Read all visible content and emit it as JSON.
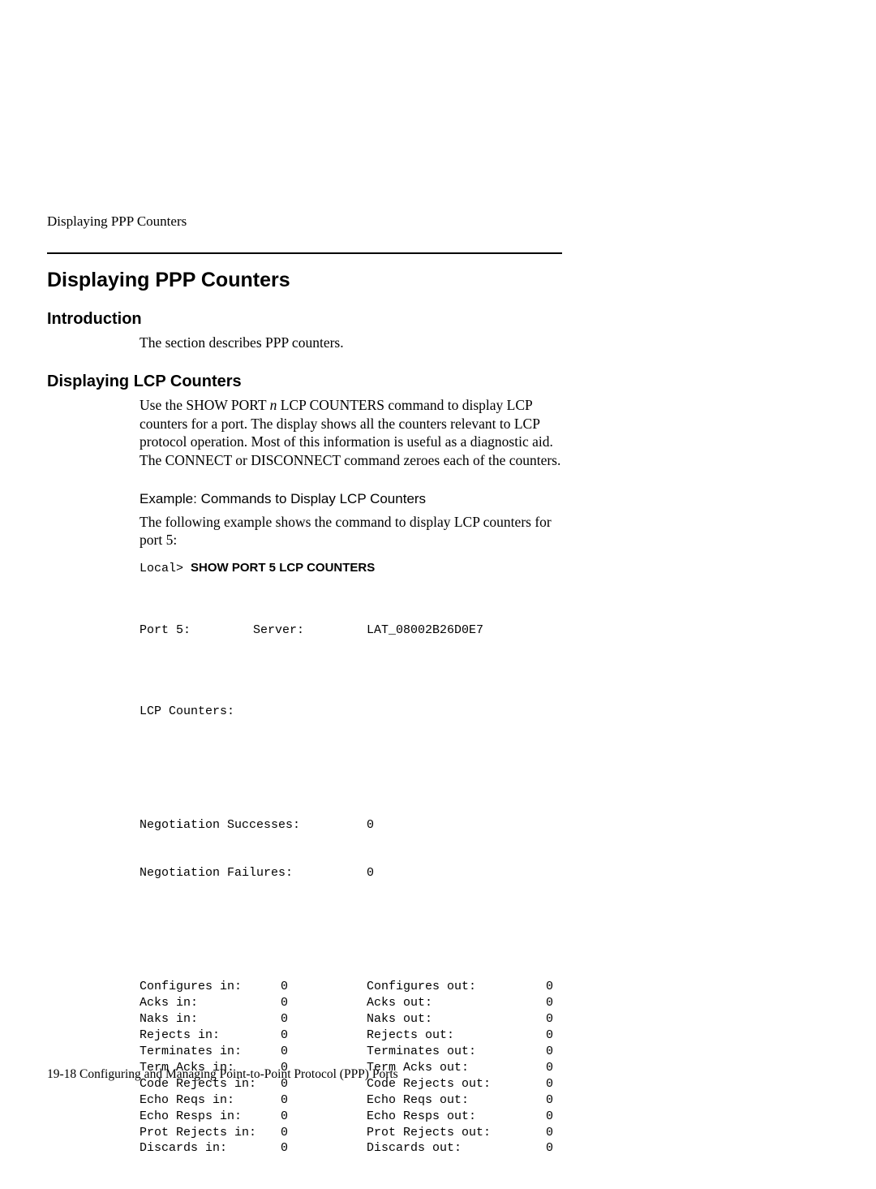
{
  "running_header": "Displaying PPP Counters",
  "h1": "Displaying PPP Counters",
  "intro": {
    "heading": "Introduction",
    "text": "The section describes PPP counters."
  },
  "lcp": {
    "heading": "Displaying LCP Counters",
    "para_before": "Use the SHOW PORT ",
    "para_em": "n",
    "para_after": " LCP COUNTERS command to display LCP counters for a port. The display shows all the counters relevant to LCP protocol operation. Most of this information is useful as a diagnostic aid. The CONNECT or DISCONNECT command zeroes each of the counters.",
    "example_heading": "Example: Commands to Display LCP Counters",
    "example_intro": "The following example shows the command to display LCP counters for port 5:",
    "prompt": "Local> ",
    "command": "SHOW PORT 5 LCP COUNTERS",
    "port_label": "Port 5:",
    "server_label": "Server:",
    "server_value": "LAT_08002B26D0E7",
    "lcp_counters_label": "LCP Counters:",
    "neg_success_label": "Negotiation Successes:",
    "neg_success_val": "0",
    "neg_fail_label": "Negotiation Failures:",
    "neg_fail_val": "0",
    "rows": [
      {
        "l": "Configures in:",
        "lv": "0",
        "r": "Configures out:",
        "rv": "0"
      },
      {
        "l": "Acks in:",
        "lv": "0",
        "r": "Acks out:",
        "rv": "0"
      },
      {
        "l": "Naks in:",
        "lv": "0",
        "r": "Naks out:",
        "rv": "0"
      },
      {
        "l": "Rejects in:",
        "lv": "0",
        "r": "Rejects out:",
        "rv": "0"
      },
      {
        "l": "Terminates in:",
        "lv": "0",
        "r": "Terminates out:",
        "rv": "0"
      },
      {
        "l": "Term Acks in:",
        "lv": "0",
        "r": "Term Acks out:",
        "rv": "0"
      },
      {
        "l": "Code Rejects in:",
        "lv": "0",
        "r": "Code Rejects out:",
        "rv": "0"
      },
      {
        "l": "Echo Reqs in:",
        "lv": "0",
        "r": "Echo Reqs out:",
        "rv": "0"
      },
      {
        "l": "Echo Resps in:",
        "lv": "0",
        "r": "Echo Resps out:",
        "rv": "0"
      },
      {
        "l": "Prot Rejects in:",
        "lv": "0",
        "r": "Prot Rejects out:",
        "rv": "0"
      },
      {
        "l": "Discards in:",
        "lv": "0",
        "r": "Discards out:",
        "rv": "0"
      }
    ]
  },
  "footer": "19-18  Configuring and Managing Point-to-Point Protocol (PPP) Ports"
}
